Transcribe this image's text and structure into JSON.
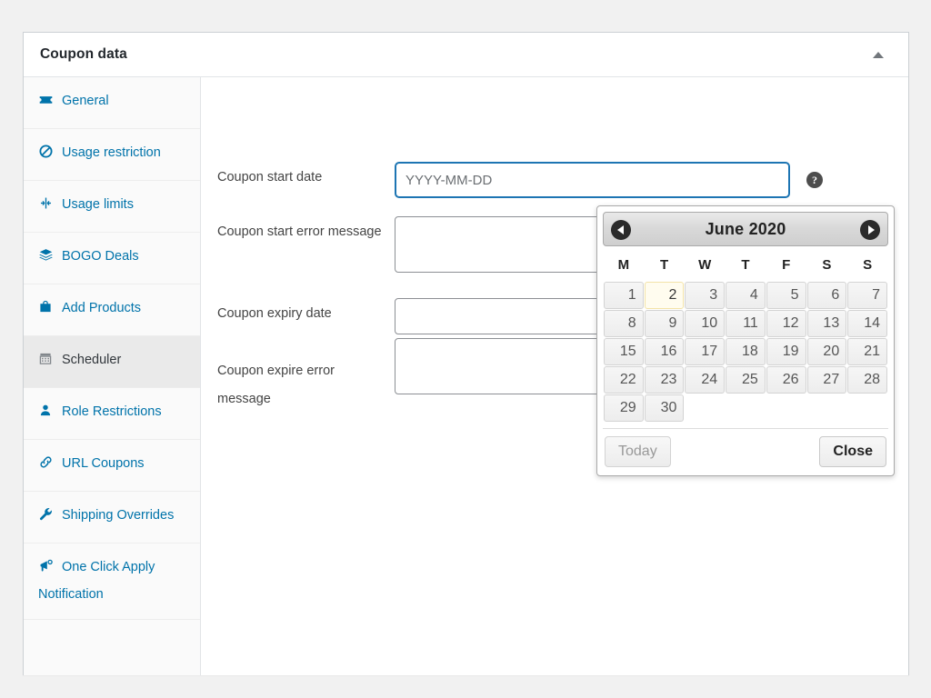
{
  "panel": {
    "title": "Coupon data",
    "toggle_icon": "caret-up-icon"
  },
  "sidebar": {
    "items": [
      {
        "label": "General",
        "icon": "ticket-icon",
        "active": false
      },
      {
        "label": "Usage restriction",
        "icon": "no-entry-icon",
        "active": false
      },
      {
        "label": "Usage limits",
        "icon": "usage-limits-icon",
        "active": false
      },
      {
        "label": "BOGO Deals",
        "icon": "layers-icon",
        "active": false
      },
      {
        "label": "Add Products",
        "icon": "bag-icon",
        "active": false
      },
      {
        "label": "Scheduler",
        "icon": "calendar-icon",
        "active": true
      },
      {
        "label": "Role Restrictions",
        "icon": "user-icon",
        "active": false
      },
      {
        "label": "URL Coupons",
        "icon": "link-icon",
        "active": false
      },
      {
        "label": "Shipping Overrides",
        "icon": "wrench-icon",
        "active": false
      },
      {
        "label": "One Click Apply Notification",
        "icon": "megaphone-icon",
        "active": false
      }
    ]
  },
  "form": {
    "fields": [
      {
        "label": "Coupon start date",
        "type": "text",
        "value": "",
        "placeholder": "YYYY-MM-DD",
        "focused": true,
        "help_icon": "help-icon"
      },
      {
        "label": "Coupon start error message",
        "type": "textarea",
        "value": "",
        "placeholder": "",
        "focused": false,
        "help_icon": "help-icon"
      },
      {
        "label": "Coupon expiry date",
        "type": "text",
        "value": "",
        "placeholder": "",
        "focused": false,
        "help_icon": "help-icon"
      },
      {
        "label": "Coupon expire error message",
        "type": "textarea",
        "value": "",
        "placeholder": "",
        "focused": false,
        "help_icon": "help-icon"
      }
    ]
  },
  "datepicker": {
    "month_title": "June 2020",
    "prev_icon": "prev-arrow-icon",
    "next_icon": "next-arrow-icon",
    "weekdays": [
      "M",
      "T",
      "W",
      "T",
      "F",
      "S",
      "S"
    ],
    "leading_blanks": 0,
    "days": [
      1,
      2,
      3,
      4,
      5,
      6,
      7,
      8,
      9,
      10,
      11,
      12,
      13,
      14,
      15,
      16,
      17,
      18,
      19,
      20,
      21,
      22,
      23,
      24,
      25,
      26,
      27,
      28,
      29,
      30
    ],
    "today": 2,
    "today_button": "Today",
    "close_button": "Close"
  },
  "colors": {
    "link": "#0073aa",
    "focus_border": "#1d75b3",
    "today_bg": "#fffcef",
    "panel_bg": "#ffffff",
    "page_bg": "#f1f1f1"
  }
}
